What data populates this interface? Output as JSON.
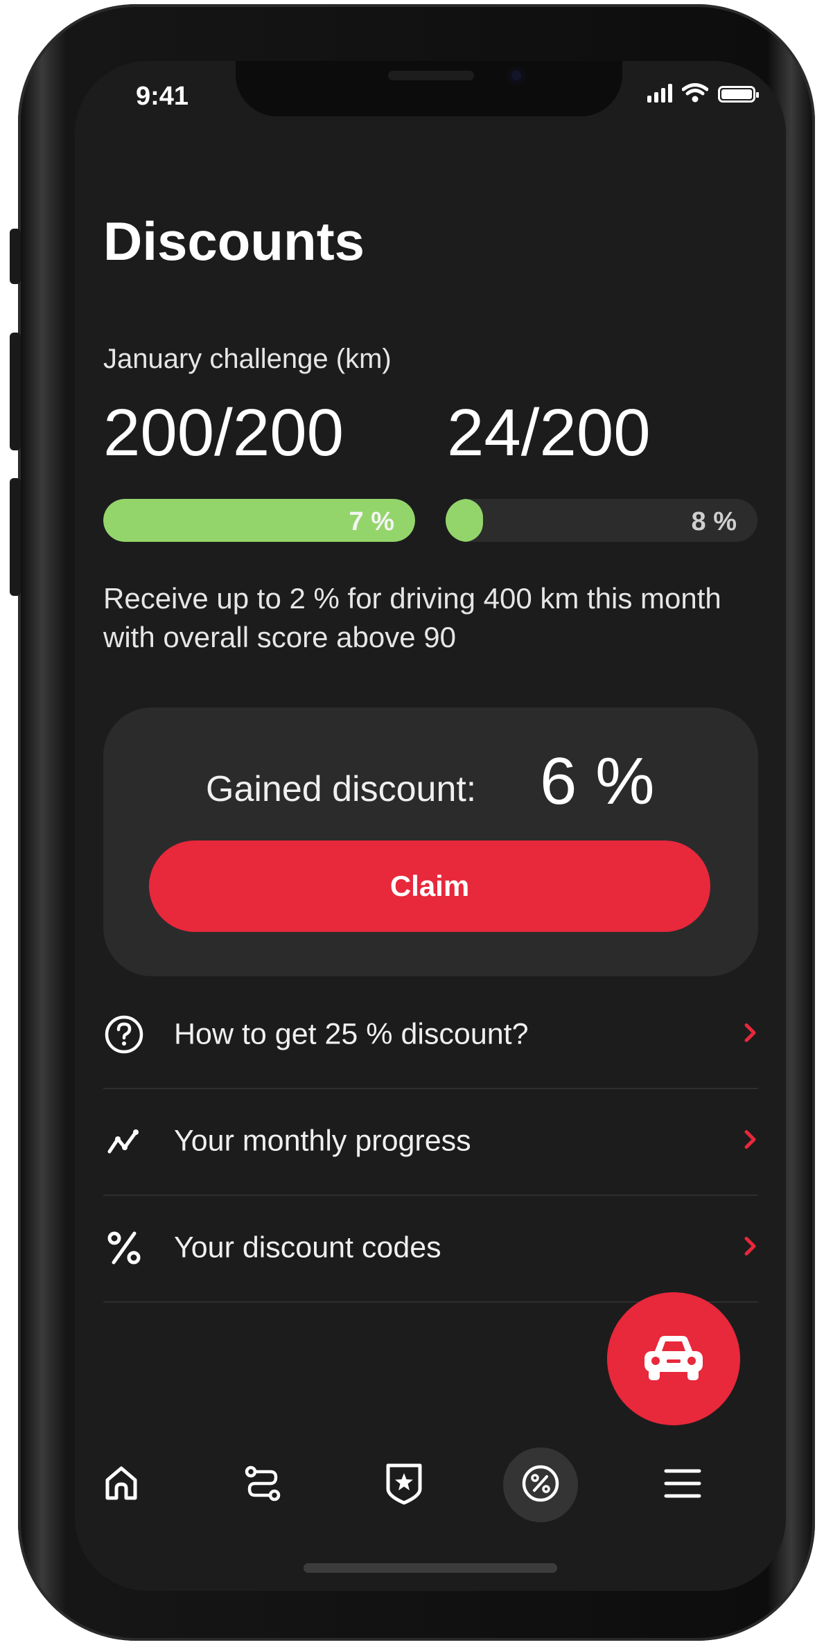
{
  "status_bar": {
    "time": "9:41"
  },
  "header": {
    "title": "Discounts"
  },
  "challenge": {
    "label": "January challenge (km)",
    "progress": [
      {
        "value": "200/200",
        "percent_label": "7 %",
        "fill": 1.0,
        "fill_color": "#93d56b"
      },
      {
        "value": "24/200",
        "percent_label": "8 %",
        "fill": 0.12,
        "fill_color": "#93d56b"
      }
    ],
    "description": "Receive up to 2 % for driving 400 km this month with overall score above 90"
  },
  "discount_card": {
    "gained_label": "Gained discount:",
    "gained_value": "6 %",
    "claim_label": "Claim"
  },
  "menu": [
    {
      "label": "How to get 25 % discount?",
      "icon": "help-circle-icon"
    },
    {
      "label": "Your monthly progress",
      "icon": "trend-line-icon"
    },
    {
      "label": "Your discount codes",
      "icon": "percent-icon"
    }
  ],
  "fab": {
    "icon": "car-icon"
  },
  "tab_bar": [
    {
      "icon": "home-icon",
      "active": false
    },
    {
      "icon": "route-icon",
      "active": false
    },
    {
      "icon": "badge-star-icon",
      "active": false
    },
    {
      "icon": "discount-icon",
      "active": true
    },
    {
      "icon": "menu-icon",
      "active": false
    }
  ],
  "colors": {
    "accent": "#e8283b",
    "progress": "#93d56b",
    "background": "#1c1c1d",
    "card": "#2b2b2c"
  }
}
